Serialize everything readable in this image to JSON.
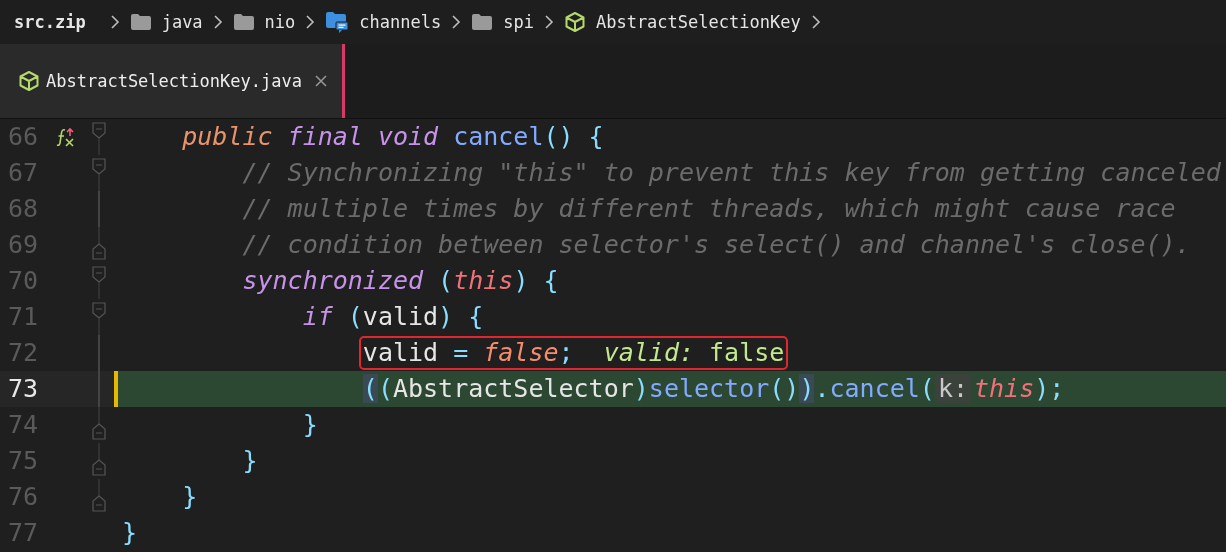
{
  "breadcrumb": [
    {
      "label": "src.zip",
      "kind": "archive"
    },
    {
      "label": "java",
      "kind": "folder"
    },
    {
      "label": "nio",
      "kind": "folder"
    },
    {
      "label": "channels",
      "kind": "package"
    },
    {
      "label": "spi",
      "kind": "folder"
    },
    {
      "label": "AbstractSelectionKey",
      "kind": "class"
    }
  ],
  "tabs": [
    {
      "label": "AbstractSelectionKey.java",
      "selected": true
    }
  ],
  "editor": {
    "lines": [
      {
        "number": "66",
        "current": false,
        "fold_start": true,
        "fold_end": false,
        "override_marker": true,
        "boxed": false,
        "tokens": [
          {
            "kind": "keyword",
            "text": "    public "
          },
          {
            "kind": "modifier",
            "text": "final void "
          },
          {
            "kind": "method",
            "text": "cancel"
          },
          {
            "kind": "punct",
            "text": "() {"
          }
        ]
      },
      {
        "number": "67",
        "current": false,
        "fold_start": true,
        "fold_end": false,
        "override_marker": false,
        "boxed": false,
        "tokens": [
          {
            "kind": "comment",
            "text": "        // Synchronizing \"this\" to prevent this key from getting canceled"
          }
        ]
      },
      {
        "number": "68",
        "current": false,
        "fold_start": false,
        "fold_end": false,
        "override_marker": false,
        "boxed": false,
        "tokens": [
          {
            "kind": "comment",
            "text": "        // multiple times by different threads, which might cause race"
          }
        ]
      },
      {
        "number": "69",
        "current": false,
        "fold_start": false,
        "fold_end": true,
        "override_marker": false,
        "boxed": false,
        "tokens": [
          {
            "kind": "comment",
            "text": "        // condition between selector's select() and channel's close()."
          }
        ]
      },
      {
        "number": "70",
        "current": false,
        "fold_start": true,
        "fold_end": false,
        "override_marker": false,
        "boxed": false,
        "tokens": [
          {
            "kind": "modifier",
            "text": "        synchronized "
          },
          {
            "kind": "punct",
            "text": "("
          },
          {
            "kind": "this",
            "text": "this"
          },
          {
            "kind": "punct",
            "text": ") {"
          }
        ]
      },
      {
        "number": "71",
        "current": false,
        "fold_start": true,
        "fold_end": false,
        "override_marker": false,
        "boxed": false,
        "tokens": [
          {
            "kind": "modifier",
            "text": "            if "
          },
          {
            "kind": "punct",
            "text": "("
          },
          {
            "kind": "plain",
            "text": "valid"
          },
          {
            "kind": "punct",
            "text": ") {"
          }
        ]
      },
      {
        "number": "72",
        "current": false,
        "fold_start": false,
        "fold_end": false,
        "override_marker": false,
        "boxed": true,
        "tokens": [
          {
            "kind": "plain",
            "text": "                valid "
          },
          {
            "kind": "punct",
            "text": "= "
          },
          {
            "kind": "literal",
            "text": "false"
          },
          {
            "kind": "punct",
            "text": ";  "
          },
          {
            "kind": "hint-name",
            "text": "valid:"
          },
          {
            "kind": "hint-value",
            "text": " false"
          }
        ]
      },
      {
        "number": "73",
        "current": true,
        "fold_start": false,
        "fold_end": false,
        "override_marker": false,
        "boxed": false,
        "tokens": [
          {
            "kind": "match",
            "text": "                ("
          },
          {
            "kind": "punct",
            "text": "("
          },
          {
            "kind": "plain",
            "text": "AbstractSelector"
          },
          {
            "kind": "punct",
            "text": ")"
          },
          {
            "kind": "method",
            "text": "selector"
          },
          {
            "kind": "punct",
            "text": "()"
          },
          {
            "kind": "match",
            "text": ")"
          },
          {
            "kind": "punct",
            "text": "."
          },
          {
            "kind": "method",
            "text": "cancel"
          },
          {
            "kind": "punct",
            "text": "("
          },
          {
            "kind": "inlay",
            "text": "k:"
          },
          {
            "kind": "this",
            "text": "this"
          },
          {
            "kind": "punct",
            "text": ");"
          }
        ]
      },
      {
        "number": "74",
        "current": false,
        "fold_start": false,
        "fold_end": true,
        "override_marker": false,
        "boxed": false,
        "tokens": [
          {
            "kind": "punct",
            "text": "            }"
          }
        ]
      },
      {
        "number": "75",
        "current": false,
        "fold_start": false,
        "fold_end": true,
        "override_marker": false,
        "boxed": false,
        "tokens": [
          {
            "kind": "punct",
            "text": "        }"
          }
        ]
      },
      {
        "number": "76",
        "current": false,
        "fold_start": false,
        "fold_end": true,
        "override_marker": false,
        "boxed": false,
        "tokens": [
          {
            "kind": "punct",
            "text": "    }"
          }
        ]
      },
      {
        "number": "77",
        "current": false,
        "fold_start": false,
        "fold_end": false,
        "override_marker": false,
        "boxed": false,
        "tokens": [
          {
            "kind": "punct",
            "text": "}"
          }
        ]
      }
    ]
  }
}
